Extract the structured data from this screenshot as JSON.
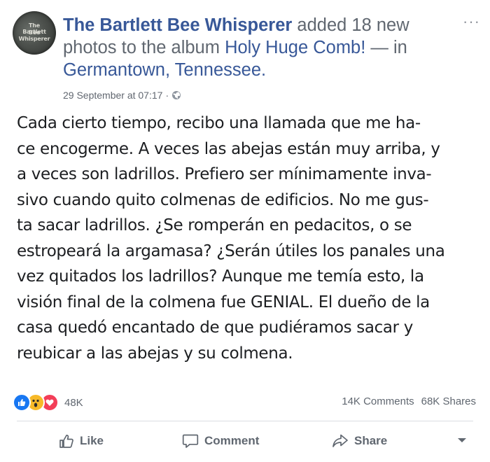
{
  "post": {
    "page_name": "The Bartlett Bee Whisperer",
    "action_text": " added 18 new photos to the album ",
    "album_name": "Holy Huge Comb!",
    "location_sep": " — in ",
    "location": "Germantown, Tennessee",
    "location_end": ".",
    "avatar_line1": "The Bartlett",
    "avatar_line2": "Bee Whisperer",
    "timestamp": "29 September at 07:17",
    "meta_sep": "·",
    "privacy_icon": "globe-icon",
    "more_label": "···",
    "body_lines": [
      "Cada cierto tiempo, recibo una llamada que me ha-",
      "ce encogerme. A veces las abejas están muy arriba, y",
      "a veces son ladrillos. Prefiero ser mínimamente inva-",
      "sivo cuando quito colmenas de edificios. No me gus-",
      "ta sacar ladrillos. ¿Se romperán en pedacitos, o se",
      "estropeará la argamasa? ¿Serán útiles los panales una",
      "vez quitados los ladrillos? Aunque me temía esto, la",
      "visión final de la colmena fue GENIAL. El dueño de la",
      "casa quedó encantado de que pudiéramos sacar y",
      "reubicar a las abejas y su colmena."
    ]
  },
  "reactions": {
    "icons": [
      "like-reaction-icon",
      "wow-reaction-icon",
      "love-reaction-icon"
    ],
    "count": "48K"
  },
  "stats": {
    "comments": "14K Comments",
    "shares": "68K Shares"
  },
  "actions": {
    "like": "Like",
    "comment": "Comment",
    "share": "Share"
  },
  "colors": {
    "link": "#385898",
    "meta": "#616770",
    "text": "#1c1e21",
    "like_blue": "#1877f2",
    "wow_yellow": "#f7b928",
    "love_red": "#f33e58"
  }
}
